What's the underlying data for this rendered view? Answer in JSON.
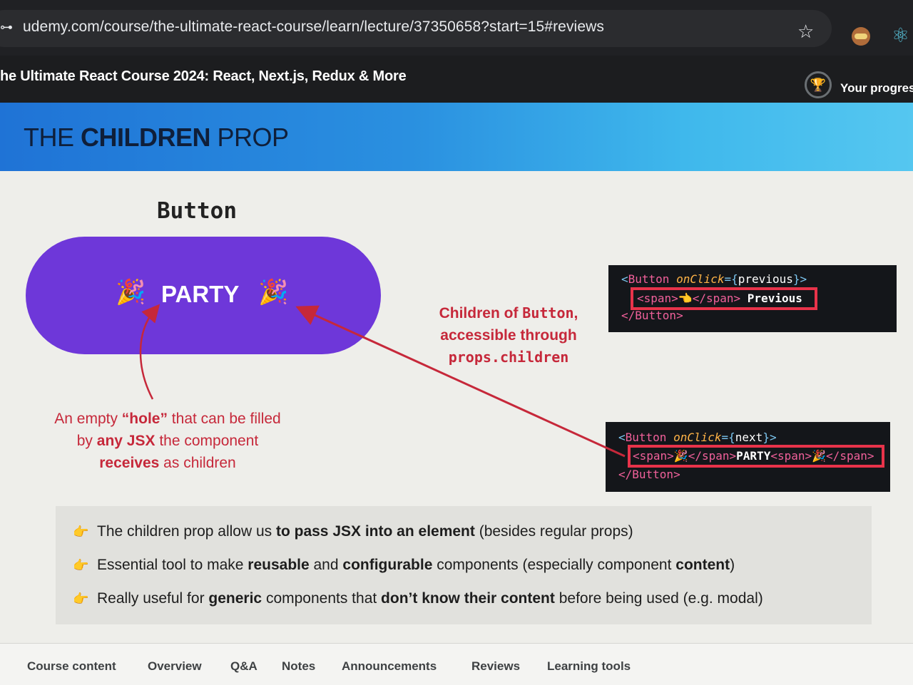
{
  "browser": {
    "url": "udemy.com/course/the-ultimate-react-course/learn/lecture/37350658?start=15#reviews",
    "site_icon": "⊶",
    "star_icon": "☆",
    "ext_icon": "⚛"
  },
  "course": {
    "title": "he Ultimate React Course 2024: React, Next.js, Redux & More",
    "progress_label": "Your progress",
    "trophy_icon": "🏆"
  },
  "slide": {
    "title_prefix": "THE ",
    "title_bold": "CHILDREN",
    "title_suffix": " PROP",
    "button_caption": "Button",
    "party_label": "PARTY",
    "popper": "🎉",
    "anno_children": {
      "line1_a": "Children of ",
      "line1_b": "Button",
      "line1_c": ",",
      "line2": "accessible through",
      "line3": "props.children"
    },
    "anno_hole": {
      "p1": "An empty ",
      "p2": "“hole”",
      "p3": " that can be filled",
      "p4": "by ",
      "p5": "any JSX",
      "p6": " the component",
      "p7": "receives",
      "p8": " as children"
    },
    "code_prev": {
      "l1_open": "<",
      "l1_tag": "Button",
      "l1_attr": " onClick",
      "l1_eq": "=",
      "l1_lb": "{",
      "l1_var": "previous",
      "l1_rb": "}",
      "l1_close": ">",
      "l2_open": "<span>",
      "l2_emoji": "👈",
      "l2_close": "</span>",
      "l2_text": " Previous",
      "l3": "</Button>"
    },
    "code_next": {
      "l1_open": "<",
      "l1_tag": "Button",
      "l1_attr": " onClick",
      "l1_eq": "=",
      "l1_lb": "{",
      "l1_var": "next",
      "l1_rb": "}",
      "l1_close": ">",
      "l2_a": "<span>",
      "l2_b": "🎉",
      "l2_c": "</span>",
      "l2_d": "PARTY",
      "l2_e": "<span>",
      "l2_f": "🎉",
      "l2_g": "</span>",
      "l3": "</Button>"
    },
    "bullets": [
      {
        "a": "The children prop allow us ",
        "b": "to pass JSX into an element",
        "c": " (besides regular props)"
      },
      {
        "a": "Essential tool to make ",
        "b": "reusable",
        "c": " and ",
        "d": "configurable",
        "e": " components (especially component ",
        "f": "content",
        "g": ")"
      },
      {
        "a": "Really useful for ",
        "b": "generic",
        "c": " components that ",
        "d": "don’t know their content",
        "e": " before being used (e.g. modal)"
      }
    ],
    "hand_icon": "👉"
  },
  "tabs": [
    "Course content",
    "Overview",
    "Q&A",
    "Notes",
    "Announcements",
    "Reviews",
    "Learning tools"
  ],
  "colors": {
    "pill": "#6e37d9",
    "annotation": "#c6283a",
    "highlight": "#e8334a",
    "header_start": "#1f73d6",
    "header_end": "#55c7f0"
  }
}
